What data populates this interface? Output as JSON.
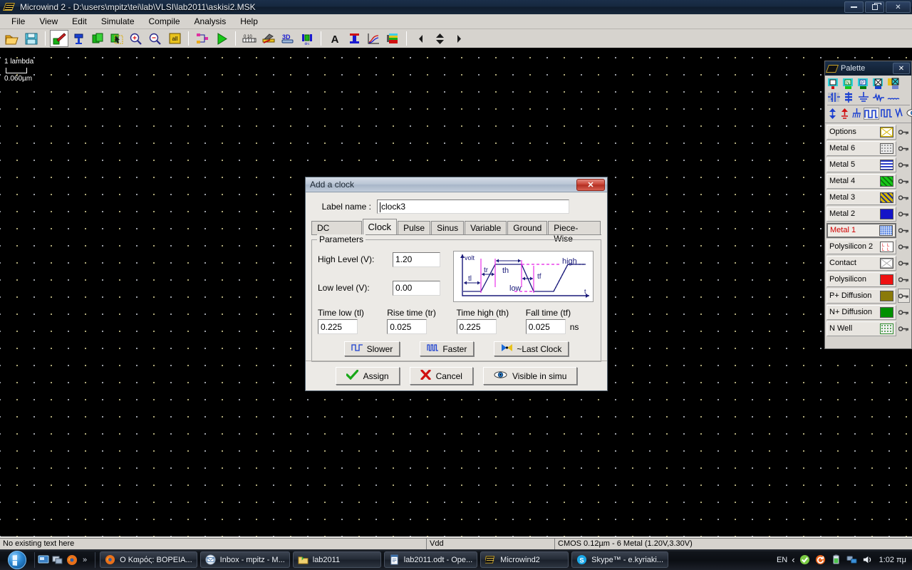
{
  "window": {
    "title": "Microwind 2 - D:\\users\\mpitz\\tei\\lab\\VLSI\\lab2011\\askisi2.MSK",
    "minimize": "–",
    "maximize": "□",
    "close": "✕"
  },
  "menu": {
    "items": [
      "File",
      "View",
      "Edit",
      "Simulate",
      "Compile",
      "Analysis",
      "Help"
    ]
  },
  "toolbar": {
    "groups": [
      [
        "open-folder-icon",
        "save-disk-icon"
      ],
      [
        "draw-box-icon",
        "polarity-tool-icon",
        "duplicate-icon",
        "move-select-icon",
        "zoom-in-icon",
        "zoom-out-icon",
        "view-all-icon"
      ],
      [
        "netlist-icon",
        "run-simulation-icon"
      ],
      [
        "measure-icon",
        "process-icon",
        "3d-view-icon",
        "drc-icon"
      ],
      [
        "text-icon",
        "vertical-cross-section-icon",
        "analog-sim-icon",
        "layer-stack-icon"
      ],
      [
        "nav-left-icon",
        "nav-updown-icon",
        "nav-right-icon"
      ]
    ]
  },
  "canvas": {
    "ruler_top": "1 lambda",
    "ruler_bottom": "0.060µm"
  },
  "palette": {
    "title": "Palette",
    "close": "✕",
    "tools_row1": [
      "vdd-supply-icon",
      "n-mos-icon",
      "p-mos-icon",
      "contact-cross-icon",
      "pad-icon"
    ],
    "tools_row2": [
      "inverter-icon",
      "resistor-stack-icon",
      "ground-icon",
      "resistor-icon",
      "inductor-icon"
    ],
    "tools_row3": [
      "vdd-arrow-icon",
      "vss-arrow-icon",
      "ground-multi-icon",
      "clock-icon",
      "pulse-icon",
      "sinus-icon",
      "visible-eye-icon"
    ],
    "layers": [
      {
        "name": "Options",
        "swatch": "options",
        "color": "#ffffff",
        "active": false
      },
      {
        "name": "Metal 6",
        "swatch": "dots-gray",
        "color": "#b8b8b8",
        "active": false
      },
      {
        "name": "Metal 5",
        "swatch": "lines-blue",
        "color": "#3f51b5",
        "active": false
      },
      {
        "name": "Metal 4",
        "swatch": "hatch-green",
        "color": "#1faa35",
        "active": false
      },
      {
        "name": "Metal 3",
        "swatch": "hatch-yellow-blue",
        "color": "#c8a800",
        "active": false
      },
      {
        "name": "Metal 2",
        "swatch": "solid-blue",
        "color": "#1414c8",
        "active": false
      },
      {
        "name": "Metal 1",
        "swatch": "dots-blue",
        "color": "#1e5ad8",
        "active": true
      },
      {
        "name": "Polysilicon 2",
        "swatch": "poly2-red",
        "color": "#e01b1b",
        "active": false
      },
      {
        "name": "Contact",
        "swatch": "contact-cross",
        "color": "#ffffff",
        "active": false
      },
      {
        "name": "Polysilicon",
        "swatch": "solid-red",
        "color": "#ee1111",
        "active": false
      },
      {
        "name": "P+ Diffusion",
        "swatch": "solid-olive",
        "color": "#8a7a0a",
        "active": false
      },
      {
        "name": "N+ Diffusion",
        "swatch": "solid-green",
        "color": "#009000",
        "active": false
      },
      {
        "name": "N Well",
        "swatch": "dots-green",
        "color": "#2e8b2e",
        "active": false
      }
    ],
    "key_icon": "key-icon",
    "active_layer_color": "#d00000"
  },
  "dialog": {
    "title": "Add a clock",
    "close": "✕",
    "label_caption": "Label name :",
    "label_value": "clock3",
    "tabs": [
      {
        "label": "DC Supply",
        "active": false
      },
      {
        "label": "Clock",
        "active": true
      },
      {
        "label": "Pulse",
        "active": false
      },
      {
        "label": "Sinus",
        "active": false
      },
      {
        "label": "Variable",
        "active": false
      },
      {
        "label": "Ground",
        "active": false
      },
      {
        "label": "Piece-Wise",
        "active": false
      }
    ],
    "parameters": {
      "legend": "Parameters",
      "high_level_label": "High Level (V):",
      "high_level_value": "1.20",
      "low_level_label": "Low level (V):",
      "low_level_value": "0.00",
      "times": [
        {
          "label": "Time low (tl)",
          "value": "0.225"
        },
        {
          "label": "Rise time (tr)",
          "value": "0.025"
        },
        {
          "label": "Time high (th)",
          "value": "0.225"
        },
        {
          "label": "Fall time (tf)",
          "value": "0.025"
        }
      ],
      "unit": "ns",
      "waveform": {
        "y_axis_label": "volt",
        "x_axis_label": "t",
        "annotations": [
          "tl",
          "tr",
          "th",
          "tf",
          "high",
          "low"
        ]
      },
      "buttons": [
        {
          "label": "Slower",
          "icon": "slow-clock-icon"
        },
        {
          "label": "Faster",
          "icon": "fast-clock-icon"
        },
        {
          "label": "~Last Clock",
          "icon": "last-clock-icon"
        }
      ]
    },
    "footer_buttons": [
      {
        "label": "Assign",
        "icon": "check-icon"
      },
      {
        "label": "Cancel",
        "icon": "cross-icon"
      },
      {
        "label": "Visible in simu",
        "icon": "eye-icon"
      }
    ]
  },
  "statusbar": {
    "message": "No existing text here",
    "node": "Vdd",
    "process": "CMOS 0.12µm - 6 Metal (1.20V,3.30V)"
  },
  "taskbar": {
    "start": "start-orb",
    "quick_launch": [
      "show-desktop-icon",
      "switch-window-icon",
      "firefox-icon"
    ],
    "chevron": "»",
    "items": [
      {
        "label": "Ο Καιρός: ΒΟΡΕΙΑ...",
        "icon": "firefox-icon"
      },
      {
        "label": "Inbox - mpitz - M...",
        "icon": "mail-icon"
      },
      {
        "label": "lab2011",
        "icon": "folder-icon"
      },
      {
        "label": "lab2011.odt - Ope...",
        "icon": "writer-icon"
      },
      {
        "label": "Microwind2",
        "icon": "microwind-icon"
      },
      {
        "label": "Skype™ - e.kyriaki...",
        "icon": "skype-icon"
      }
    ],
    "tray": {
      "language": "EN",
      "chevron": "‹",
      "icons": [
        "antivirus-icon",
        "update-icon",
        "battery-icon",
        "network-icon",
        "volume-icon"
      ],
      "time": "1:02 πμ"
    }
  }
}
